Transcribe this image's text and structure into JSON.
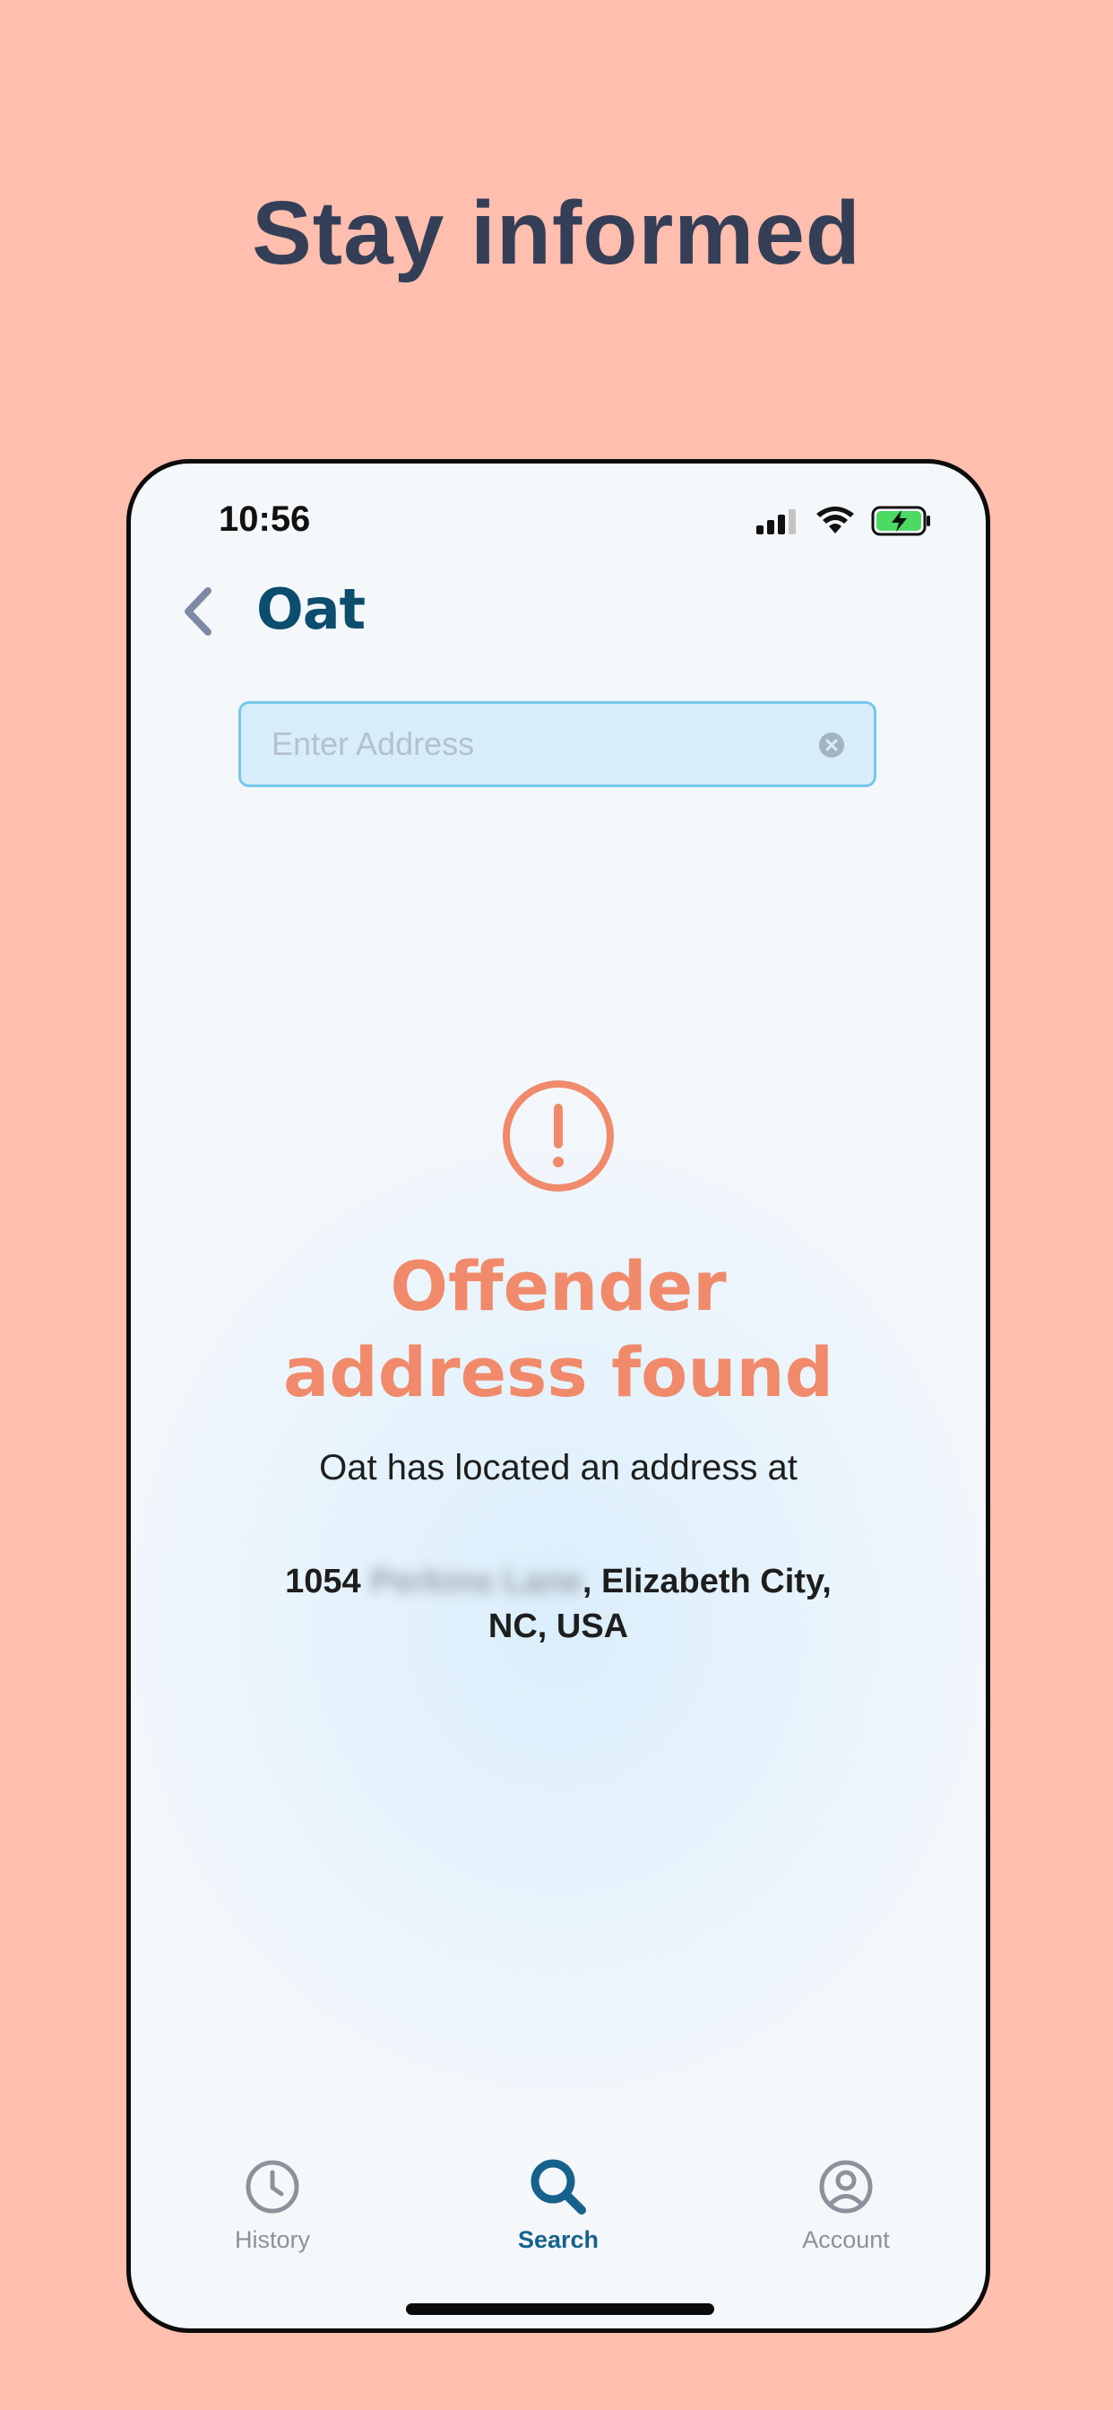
{
  "headline": "Stay informed",
  "status_bar": {
    "time": "10:56"
  },
  "app": {
    "logo_text": "Oat"
  },
  "search": {
    "placeholder": "Enter Address",
    "value": ""
  },
  "result": {
    "title_line1": "Offender",
    "title_line2": "address found",
    "subtitle": "Oat has located an address at",
    "address_number": "1054",
    "address_street_blurred": "Perkins Lane",
    "address_city": ", Elizabeth City,",
    "address_region": "NC, USA"
  },
  "tabbar": {
    "items": [
      {
        "label": "History",
        "icon": "clock-icon",
        "active": false
      },
      {
        "label": "Search",
        "icon": "search-icon",
        "active": true
      },
      {
        "label": "Account",
        "icon": "user-circle-icon",
        "active": false
      }
    ]
  },
  "colors": {
    "background": "#FFBEAE",
    "headline": "#343F57",
    "accent": "#F08A6B",
    "brand": "#0D4D6E",
    "active_tab": "#17628C",
    "search_border": "#75C7EC",
    "search_fill": "#D7EDFA",
    "battery_fill": "#4CD964"
  }
}
